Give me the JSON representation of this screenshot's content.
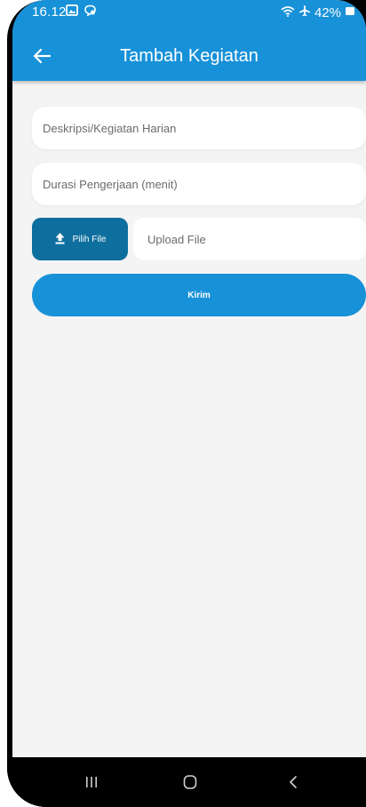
{
  "status_bar": {
    "time": "16.12",
    "battery": "42%"
  },
  "app_bar": {
    "title": "Tambah Kegiatan",
    "back_icon": "arrow-left-icon",
    "color": "#1791d8"
  },
  "form": {
    "description_placeholder": "Deskripsi/Kegiatan Harian",
    "duration_placeholder": "Durasi Pengerjaan (menit)",
    "pick_file_label": "Pilih File",
    "upload_placeholder": "Upload File",
    "submit_label": "Kirim"
  },
  "nav_bar": {
    "items": [
      "recent-apps-icon",
      "home-icon",
      "back-icon"
    ]
  }
}
